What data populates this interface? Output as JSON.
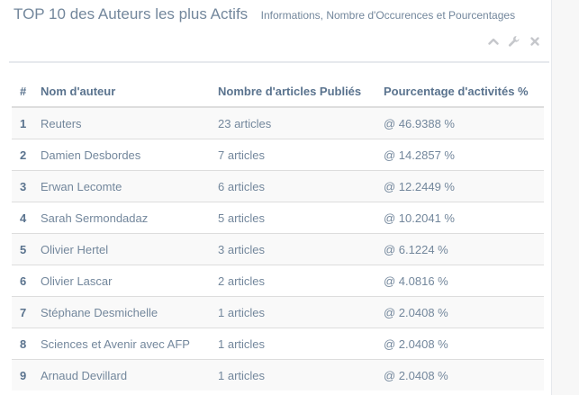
{
  "header": {
    "title": "TOP 10 des Auteurs les plus Actifs",
    "subtitle": "Informations, Nombre d'Occurences et Pourcentages",
    "tools": [
      "chevron-up-icon",
      "wrench-icon",
      "close-icon"
    ]
  },
  "table": {
    "columns": [
      "#",
      "Nom d'auteur",
      "Nombre d'articles Publiés",
      "Pourcentage d'activités %"
    ],
    "rows": [
      {
        "rank": "1",
        "author": "Reuters",
        "articles": "23 articles",
        "percent": "@ 46.9388 %"
      },
      {
        "rank": "2",
        "author": "Damien Desbordes",
        "articles": "7 articles",
        "percent": "@ 14.2857 %"
      },
      {
        "rank": "3",
        "author": "Erwan Lecomte",
        "articles": "6 articles",
        "percent": "@ 12.2449 %"
      },
      {
        "rank": "4",
        "author": "Sarah Sermondadaz",
        "articles": "5 articles",
        "percent": "@ 10.2041 %"
      },
      {
        "rank": "5",
        "author": "Olivier Hertel",
        "articles": "3 articles",
        "percent": "@ 6.1224 %"
      },
      {
        "rank": "6",
        "author": "Olivier Lascar",
        "articles": "2 articles",
        "percent": "@ 4.0816 %"
      },
      {
        "rank": "7",
        "author": "Stéphane Desmichelle",
        "articles": "1 articles",
        "percent": "@ 2.0408 %"
      },
      {
        "rank": "8",
        "author": "Sciences et Avenir avec AFP",
        "articles": "1 articles",
        "percent": "@ 2.0408 %"
      },
      {
        "rank": "9",
        "author": "Arnaud Devillard",
        "articles": "1 articles",
        "percent": "@ 2.0408 %"
      }
    ]
  },
  "colors": {
    "text": "#73879c",
    "heading": "#5a738e",
    "stripe": "#f9f9f9",
    "border": "#dddddd",
    "icon": "#c5c7cb"
  }
}
